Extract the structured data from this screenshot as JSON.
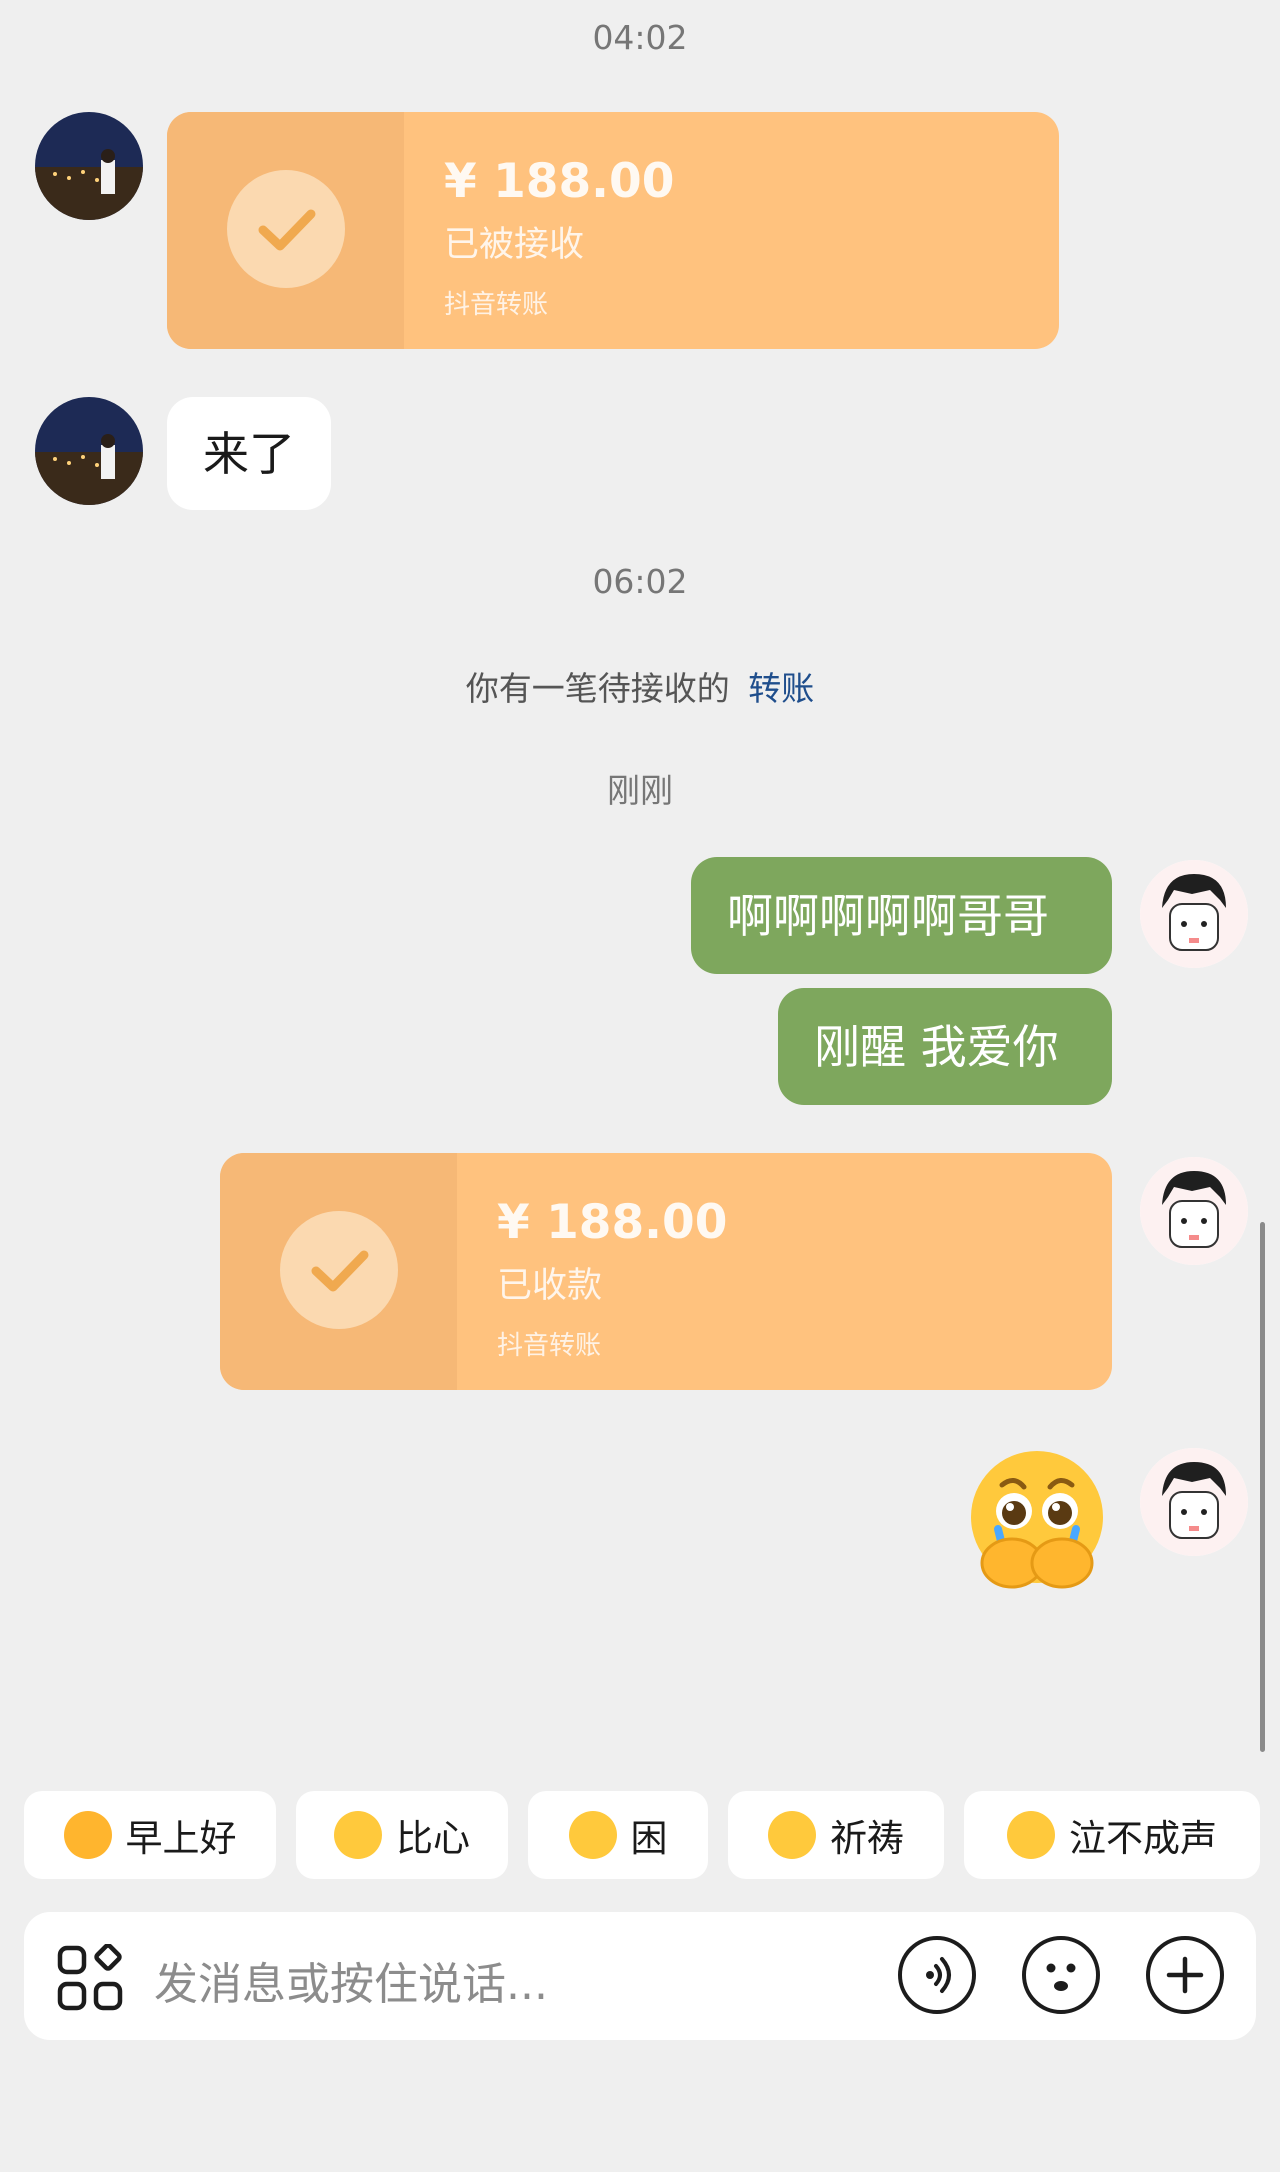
{
  "timestamps": {
    "first": "04:02",
    "second": "06:02",
    "third": "刚刚"
  },
  "messages": {
    "transfer_received": {
      "amount": "¥ 188.00",
      "status": "已被接收",
      "source": "抖音转账"
    },
    "text_1": "来了",
    "system_notice": {
      "text": "你有一笔待接收的",
      "link": "转账"
    },
    "sent_1": "啊啊啊啊啊哥哥",
    "sent_2": "刚醒 我爱你",
    "transfer_sent": {
      "amount": "¥ 188.00",
      "status": "已收款",
      "source": "抖音转账"
    },
    "sticker": "crying-face-hands-emoji"
  },
  "quick_replies": [
    {
      "label": "早上好",
      "icon": "sun-emoji"
    },
    {
      "label": "比心",
      "icon": "heart-hand-emoji"
    },
    {
      "label": "困",
      "icon": "sleepy-emoji"
    },
    {
      "label": "祈祷",
      "icon": "pray-emoji"
    },
    {
      "label": "泣不成声",
      "icon": "crying-emoji"
    }
  ],
  "input": {
    "placeholder": "发消息或按住说话..."
  },
  "colors": {
    "background": "#efefef",
    "sent_bubble": "#7ea75d",
    "transfer_card": "#ffc27e",
    "link": "#1f4e8c"
  }
}
